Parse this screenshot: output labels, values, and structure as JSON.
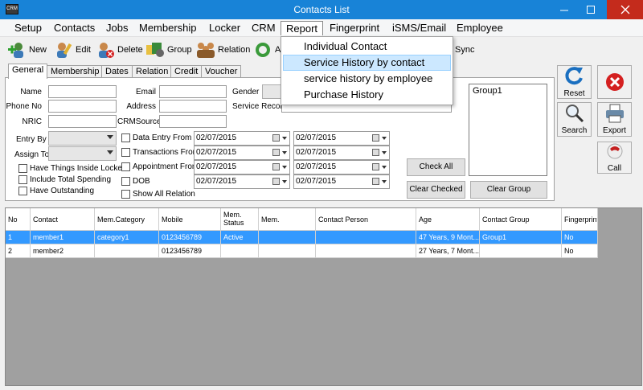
{
  "window": {
    "title": "Contacts List",
    "app_icon_text": "CRM"
  },
  "menu": [
    "Setup",
    "Contacts",
    "Jobs",
    "Membership",
    "Locker",
    "CRM",
    "Report",
    "Fingerprint",
    "iSMS/Email",
    "Employee"
  ],
  "toolbar": {
    "new": "New",
    "edit": "Edit",
    "delete": "Delete",
    "group": "Group",
    "relation": "Relation",
    "hidden": "A",
    "sync": "Sync"
  },
  "report_menu": [
    "Individual Contact",
    "Service History by contact",
    "service history by employee",
    "Purchase History"
  ],
  "tabs": [
    "General",
    "Membership",
    "Dates",
    "Relation",
    "Credit",
    "Voucher"
  ],
  "form": {
    "name": "Name",
    "phone": "Phone No",
    "nric": "NRIC",
    "entry_by": "Entry By",
    "assign_to": "Assign To",
    "email": "Email",
    "address": "Address",
    "crm_source": "CRMSource",
    "gender": "Gender",
    "service_record": "Service Record",
    "have_things_locker": "Have Things Inside Locker",
    "include_total_spending": "Include Total Spending",
    "have_outstanding": "Have Outstanding",
    "data_entry_from": "Data Entry From",
    "transactions_from": "Transactions From",
    "appointment_from": "Appointment From",
    "dob": "DOB",
    "show_all_relation": "Show All Relation",
    "dates": [
      "02/07/2015",
      "02/07/2015",
      "02/07/2015",
      "02/07/2015",
      "02/07/2015",
      "02/07/2015",
      "02/07/2015",
      "02/07/2015"
    ],
    "check_all": "Check All",
    "clear_checked": "Clear Checked",
    "clear_group": "Clear Group",
    "group_items": [
      "Group1"
    ]
  },
  "side": {
    "reset": "Reset",
    "search": "Search",
    "export": "Export",
    "call": "Call"
  },
  "grid": {
    "columns": [
      "No",
      "Contact",
      "Mem.Category",
      "Mobile",
      "Mem. Status",
      "Mem.",
      "Contact Person",
      "Age",
      "Contact Group",
      "Fingerprint"
    ],
    "rows": [
      [
        "1",
        "member1",
        "category1",
        "0123456789",
        "Active",
        "",
        "",
        "47 Years, 9 Mont...",
        "Group1",
        "No"
      ],
      [
        "2",
        "member2",
        "",
        "0123456789",
        "",
        "",
        "",
        "27 Years, 7 Mont...",
        "",
        "No"
      ]
    ]
  },
  "colors": {
    "titlebar": "#1883d7",
    "close": "#c42b1c",
    "selection": "#3399ff",
    "menu_highlight": "#cce8ff"
  }
}
